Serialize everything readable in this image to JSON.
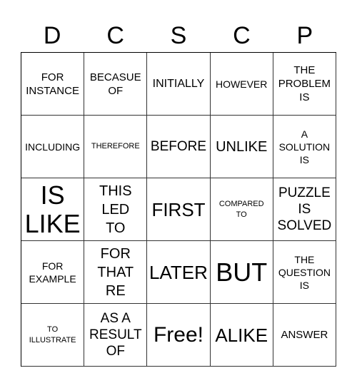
{
  "header": {
    "letters": [
      "D",
      "C",
      "S",
      "C",
      "P"
    ]
  },
  "cells": [
    "FOR INSTANCE",
    "BECASUE OF",
    "INITIALLY",
    "HOWEVER",
    "THE PROBLEM IS",
    "INCLUDING",
    "THEREFORE",
    "BEFORE",
    "UNLIKE",
    "A SOLUTION IS",
    "IS LIKE",
    "THIS LED TO",
    "FIRST",
    "COMPARED TO",
    "PUZZLE IS SOLVED",
    "FOR EXAMPLE",
    "FOR THAT RE",
    "LATER",
    "BUT",
    "THE QUESTION IS",
    "TO ILLUSTRATE",
    "AS A RESULT OF",
    "Free!",
    "ALIKE",
    "ANSWER"
  ]
}
